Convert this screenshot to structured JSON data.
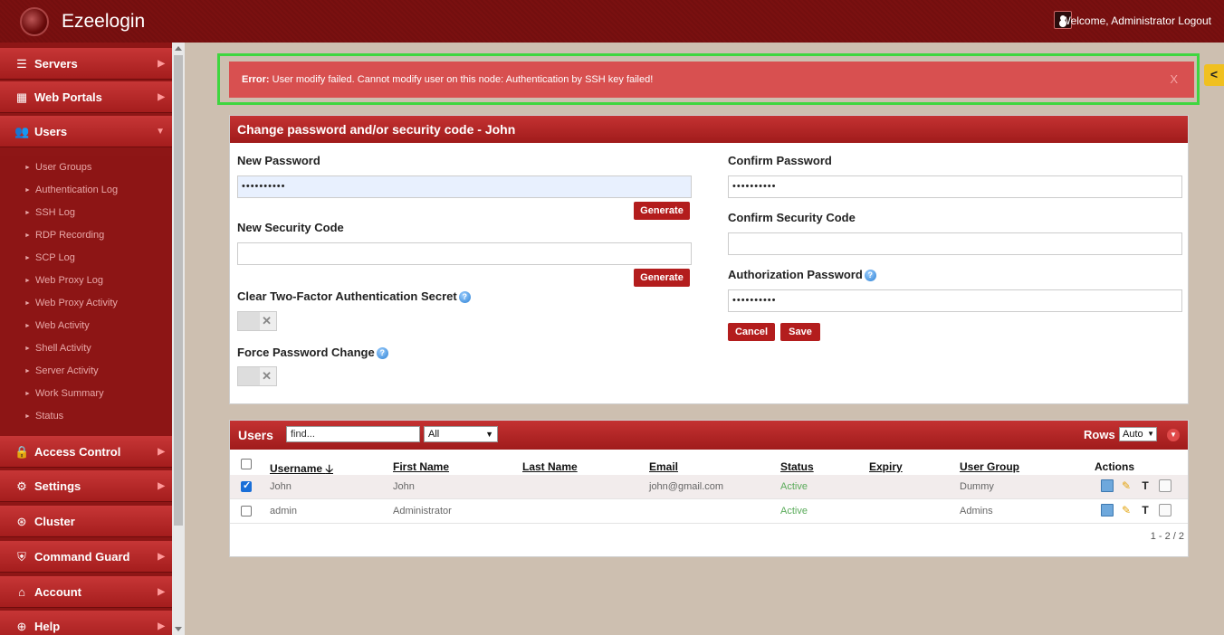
{
  "app": {
    "title": "Ezeelogin",
    "welcome": "Welcome, Administrator Logout"
  },
  "sidebar": {
    "items": [
      {
        "label": "Servers",
        "icon": "list-icon"
      },
      {
        "label": "Web Portals",
        "icon": "grid-icon"
      },
      {
        "label": "Users",
        "icon": "users-icon"
      },
      {
        "label": "Access Control",
        "icon": "lock-icon"
      },
      {
        "label": "Settings",
        "icon": "gears-icon"
      },
      {
        "label": "Cluster",
        "icon": "cluster-icon"
      },
      {
        "label": "Command Guard",
        "icon": "shield-icon"
      },
      {
        "label": "Account",
        "icon": "home-icon"
      },
      {
        "label": "Help",
        "icon": "lifebuoy-icon"
      }
    ],
    "users_submenu": [
      "User Groups",
      "Authentication Log",
      "SSH Log",
      "RDP Recording",
      "SCP Log",
      "Web Proxy Log",
      "Web Proxy Activity",
      "Web Activity",
      "Shell Activity",
      "Server Activity",
      "Work Summary",
      "Status"
    ]
  },
  "alert": {
    "prefix": "Error:",
    "message": "User modify failed. Cannot modify user on this node: Authentication by SSH key failed!",
    "close": "X"
  },
  "form": {
    "title": "Change password and/or security code - John",
    "new_password_label": "New Password",
    "new_password_value": "••••••••••",
    "confirm_password_label": "Confirm Password",
    "confirm_password_value": "••••••••••",
    "generate_label": "Generate",
    "new_security_code_label": "New Security Code",
    "confirm_security_code_label": "Confirm Security Code",
    "authorization_password_label": "Authorization Password",
    "authorization_password_value": "••••••••••",
    "clear_2fa_label": "Clear Two-Factor Authentication Secret",
    "force_password_change_label": "Force Password Change",
    "cancel_label": "Cancel",
    "save_label": "Save"
  },
  "users": {
    "title": "Users",
    "find_placeholder": "find...",
    "filter_value": "All",
    "rows_label": "Rows",
    "rows_value": "Auto",
    "columns": [
      "Username",
      "First Name",
      "Last Name",
      "Email",
      "Status",
      "Expiry",
      "User Group",
      "Actions"
    ],
    "sort_arrow": "🡣",
    "rows": [
      {
        "username": "John",
        "first_name": "John",
        "last_name": "",
        "email": "john@gmail.com",
        "status": "Active",
        "expiry": "",
        "user_group": "Dummy",
        "checked": true
      },
      {
        "username": "admin",
        "first_name": "Administrator",
        "last_name": "",
        "email": "",
        "status": "Active",
        "expiry": "",
        "user_group": "Admins",
        "checked": false
      }
    ],
    "pager": "1 - 2 / 2"
  },
  "colors": {
    "brand": "#a51d1d",
    "alert": "#d85050",
    "highlight_border": "#3fd63f",
    "status_active": "#5aab5a"
  }
}
